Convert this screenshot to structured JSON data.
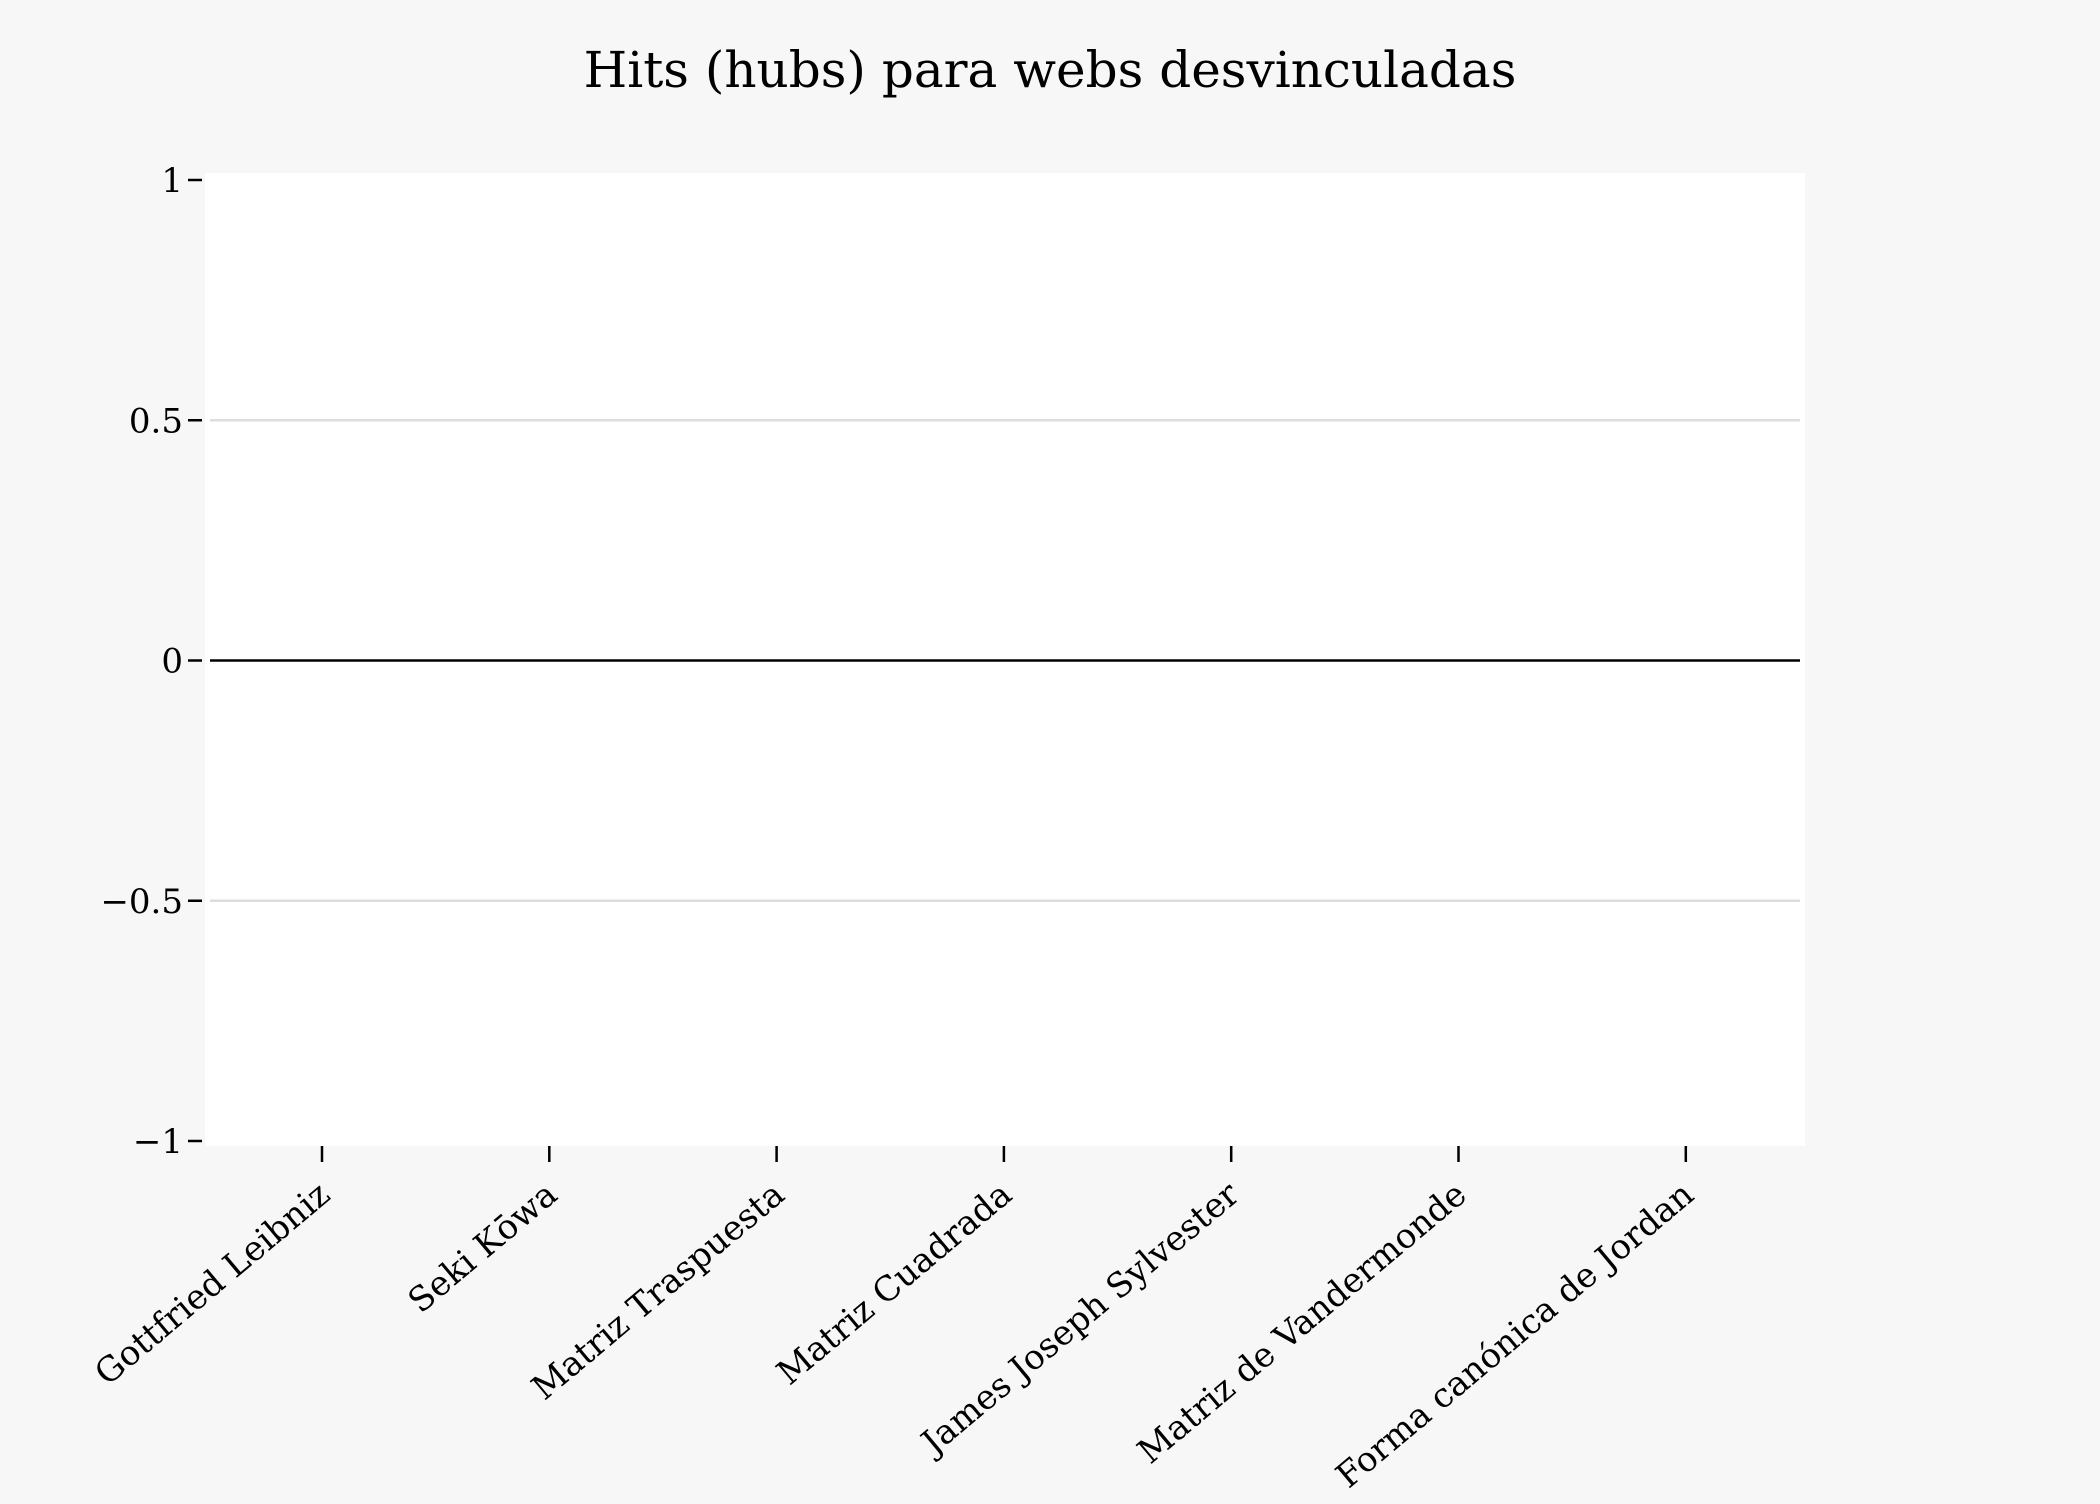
{
  "chart_data": {
    "type": "bar",
    "title": "Hits (hubs) para webs desvinculadas",
    "xlabel": "",
    "ylabel": "",
    "categories": [
      "Gottfried Leibniz",
      "Seki Kōwa",
      "Matriz Traspuesta",
      "Matriz Cuadrada",
      "James Joseph Sylvester",
      "Matriz de Vandermonde",
      "Forma canónica de Jordan"
    ],
    "values": [
      0,
      0,
      0,
      0,
      0,
      0,
      0
    ],
    "ylim": [
      -1,
      1
    ],
    "yticks": [
      -1,
      -0.5,
      0,
      0.5,
      1
    ],
    "ytick_labels": [
      "−1",
      "−0.5",
      "0",
      "0.5",
      "1"
    ],
    "grid": true,
    "legend": "none"
  },
  "colors": {
    "figure_background": "#f7f7f7",
    "plot_background": "#ffffff",
    "grid": "#dddddd",
    "zero_line": "#000000",
    "bar": "#1f77b4"
  }
}
